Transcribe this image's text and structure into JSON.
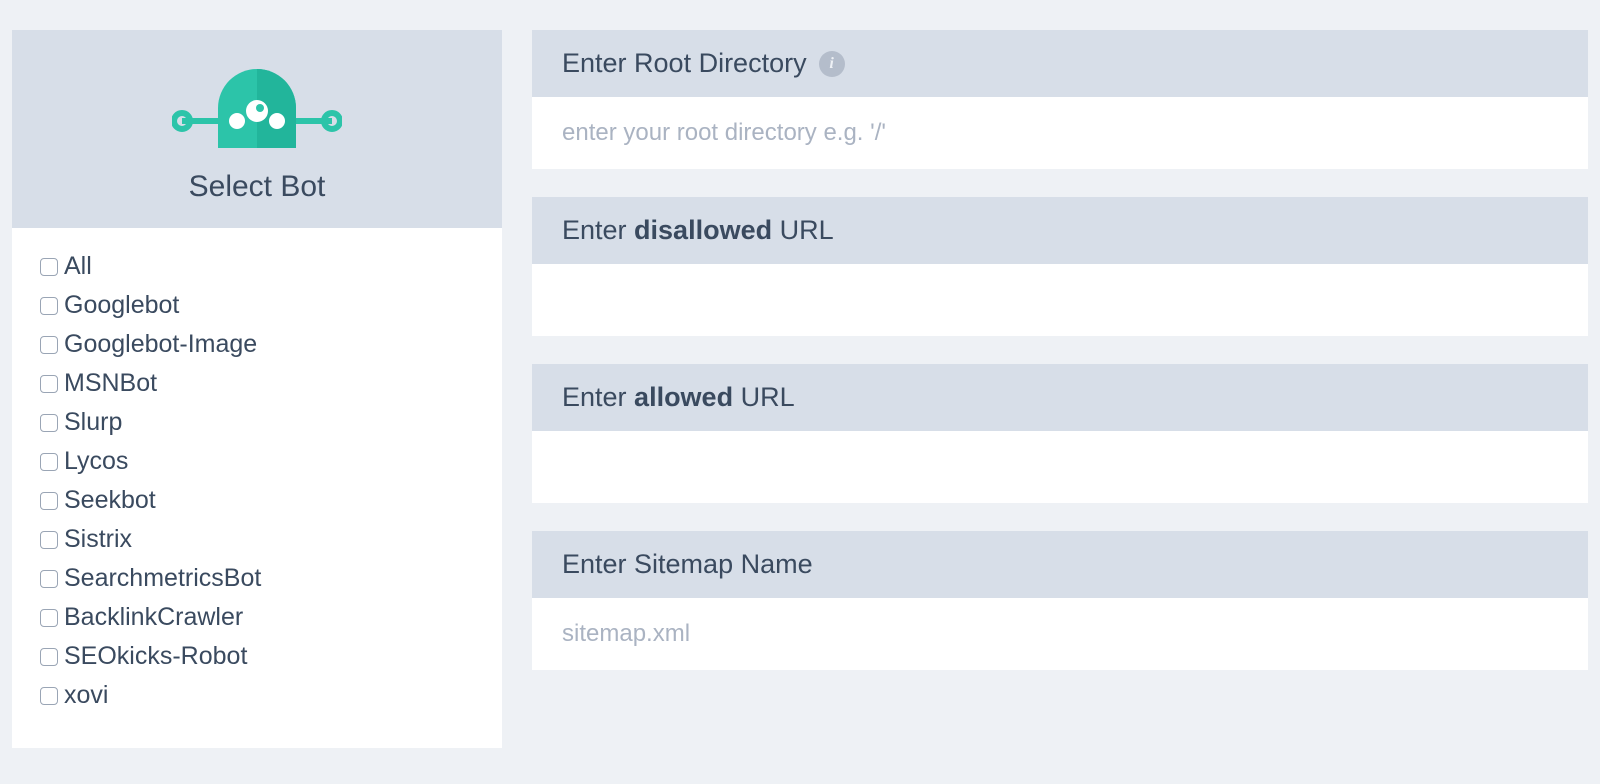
{
  "sidebar": {
    "title": "Select Bot",
    "bots": [
      "All",
      "Googlebot",
      "Googlebot-Image",
      "MSNBot",
      "Slurp",
      "Lycos",
      "Seekbot",
      "Sistrix",
      "SearchmetricsBot",
      "BacklinkCrawler",
      "SEOkicks-Robot",
      "xovi"
    ]
  },
  "sections": {
    "rootDir": {
      "prefix": "Enter Root Directory",
      "placeholder": "enter your root directory e.g. '/'"
    },
    "disallowed": {
      "prefix": "Enter ",
      "bold": "disallowed",
      "suffix": " URL"
    },
    "allowed": {
      "prefix": "Enter ",
      "bold": "allowed",
      "suffix": " URL"
    },
    "sitemap": {
      "prefix": "Enter Sitemap Name",
      "placeholder": "sitemap.xml"
    }
  }
}
